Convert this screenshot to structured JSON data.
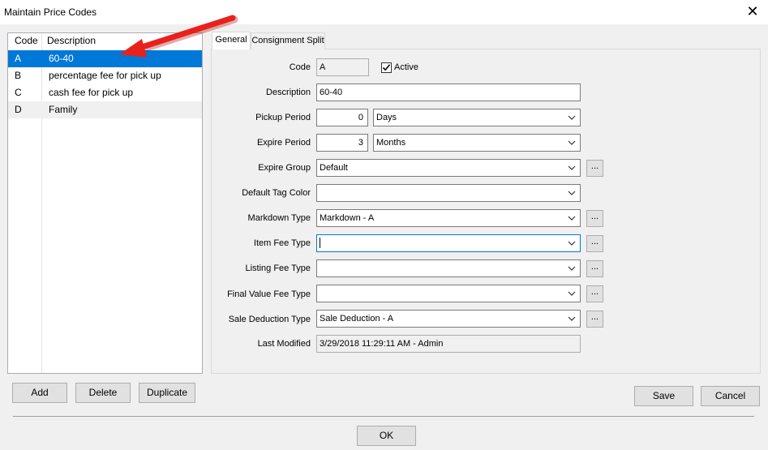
{
  "window": {
    "title": "Maintain Price Codes",
    "close_symbol": "✕"
  },
  "list": {
    "headers": [
      "Code",
      "Description"
    ],
    "rows": [
      {
        "code": "A",
        "description": "60-40"
      },
      {
        "code": "B",
        "description": "percentage fee for pick up"
      },
      {
        "code": "C",
        "description": "cash fee for pick up"
      },
      {
        "code": "D",
        "description": "Family"
      }
    ],
    "selected_code": "A"
  },
  "list_buttons": {
    "add": "Add",
    "delete": "Delete",
    "duplicate": "Duplicate"
  },
  "tabs": [
    "General",
    "Consignment Split"
  ],
  "active_tab": "General",
  "form": {
    "code": {
      "label": "Code",
      "value": "A"
    },
    "active": {
      "label": "Active",
      "checked": true
    },
    "description": {
      "label": "Description",
      "value": "60-40"
    },
    "pickup_period": {
      "label": "Pickup Period",
      "value": "0",
      "unit": "Days"
    },
    "expire_period": {
      "label": "Expire Period",
      "value": "3",
      "unit": "Months"
    },
    "expire_group": {
      "label": "Expire Group",
      "value": "Default"
    },
    "default_tag_color": {
      "label": "Default Tag Color",
      "value": ""
    },
    "markdown_type": {
      "label": "Markdown Type",
      "value": "Markdown - A"
    },
    "item_fee_type": {
      "label": "Item Fee Type",
      "value": ""
    },
    "listing_fee_type": {
      "label": "Listing Fee Type",
      "value": ""
    },
    "final_value_fee_type": {
      "label": "Final Value Fee Type",
      "value": ""
    },
    "sale_deduction_type": {
      "label": "Sale Deduction Type",
      "value": "Sale Deduction - A"
    },
    "last_modified": {
      "label": "Last Modified",
      "value": "3/29/2018 11:29:11 AM - Admin"
    }
  },
  "ellipsis_label": "...",
  "dialog_buttons": {
    "save": "Save",
    "cancel": "Cancel",
    "ok": "OK"
  },
  "colors": {
    "selection": "#0078d7",
    "annotation_arrow": "#e8211d"
  },
  "icons": {
    "close": "close-icon",
    "dropdown": "chevron-down-icon",
    "check": "checkmark-icon",
    "annotation": "red-arrow-icon"
  }
}
